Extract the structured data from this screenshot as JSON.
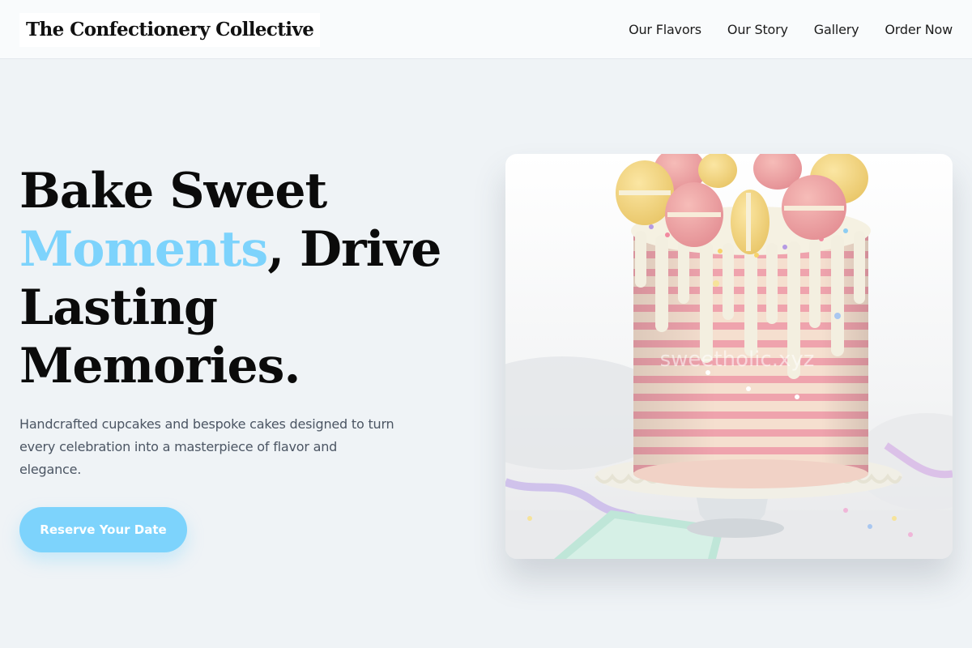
{
  "brand": {
    "name": "The Confectionery Collective"
  },
  "nav": {
    "items": [
      {
        "label": "Our Flavors"
      },
      {
        "label": "Our Story"
      },
      {
        "label": "Gallery"
      },
      {
        "label": "Order Now"
      }
    ]
  },
  "hero": {
    "title_part1": "Bake Sweet ",
    "title_accent": "Moments",
    "title_part2": ", Drive Lasting Memories.",
    "subtitle": "Handcrafted cupcakes and bespoke cakes designed to turn every celebration into a masterpiece of flavor and elegance.",
    "cta_label": "Reserve Your Date",
    "image_watermark": "sweetholic.xyz"
  },
  "colors": {
    "accent": "#7dd3fc",
    "background": "#eff3f6",
    "header_bg": "#f9fbfc",
    "text_primary": "#0b0b0b",
    "text_secondary": "#4b5563"
  }
}
